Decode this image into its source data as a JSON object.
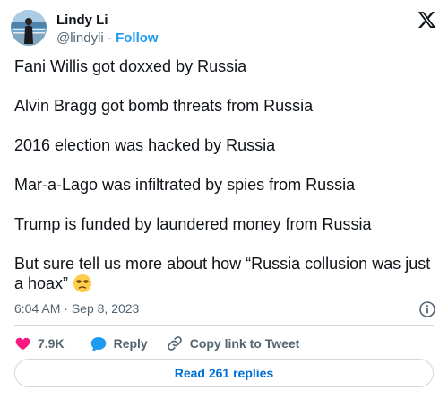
{
  "author": {
    "display_name": "Lindy Li",
    "handle": "@lindyli",
    "separator": " · ",
    "follow_label": "Follow"
  },
  "platform_icon": "x-logo-icon",
  "tweet": {
    "lines": [
      "Fani Willis got doxxed by Russia",
      "Alvin Bragg got bomb threats from Russia",
      "2016 election was hacked by Russia",
      "Mar-a-Lago was infiltrated by spies from Russia",
      "Trump is funded by laundered money from Russia",
      "But sure tell us more about how “Russia  collusion was just a hoax” "
    ],
    "emoji": "unamused-face-emoji"
  },
  "meta": {
    "time": "6:04 AM",
    "separator": " · ",
    "date": "Sep 8, 2023"
  },
  "actions": {
    "like_count": "7.9K",
    "reply_label": "Reply",
    "copy_label": "Copy link to Tweet"
  },
  "read_replies_label": "Read 261 replies",
  "colors": {
    "text": "#0f1419",
    "secondary": "#536471",
    "link": "#1d9bf0",
    "like_red": "#f91880",
    "reply_blue": "#1d9bf0",
    "border": "#cfd9de",
    "read_replies": "#006fd6"
  }
}
